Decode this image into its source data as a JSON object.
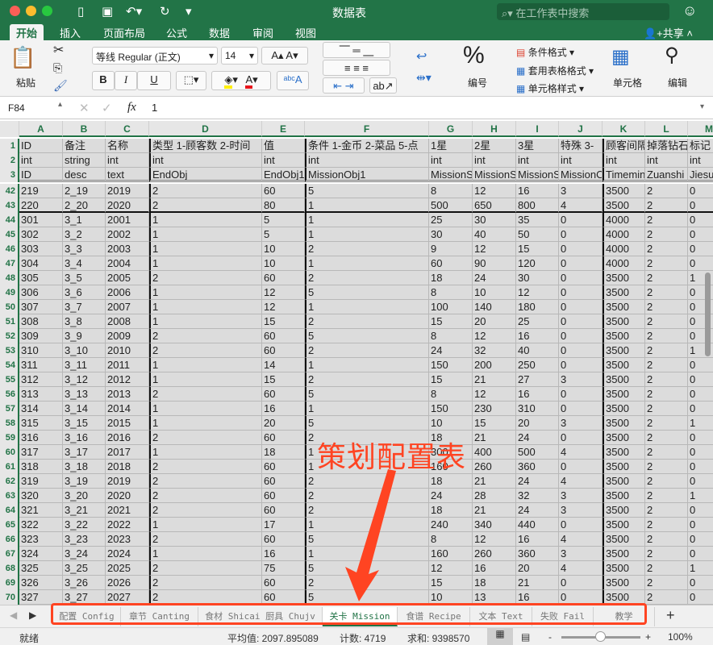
{
  "window": {
    "title": "数据表",
    "search_placeholder": "在工作表中搜索"
  },
  "ribbon_tabs": [
    "开始",
    "插入",
    "页面布局",
    "公式",
    "数据",
    "审阅",
    "视图"
  ],
  "share_label": "共享",
  "ribbon": {
    "paste": "粘贴",
    "font_name": "等线 Regular (正文)",
    "font_size": "14",
    "bold": "B",
    "italic": "I",
    "underline": "U",
    "number": "编号",
    "number_symbol": "%",
    "cond_format": "条件格式",
    "table_format": "套用表格格式",
    "cell_style": "单元格样式",
    "cells": "单元格",
    "edit": "编辑",
    "colors": {
      "highlight": "#ffef00",
      "font_color": "#e8141b"
    }
  },
  "formula_bar": {
    "name_box": "F84",
    "fx": "fx",
    "value": "1"
  },
  "columns": [
    "A",
    "B",
    "C",
    "D",
    "E",
    "F",
    "G",
    "H",
    "I",
    "J",
    "K",
    "L",
    "M"
  ],
  "header_rows": [
    {
      "num": "1",
      "cells": [
        "ID",
        "备注",
        "名称",
        "类型 1-顾客数 2-时间",
        "值",
        "条件 1-金币 2-菜品 5-点",
        "1星",
        "2星",
        "3星",
        "特殊 3-",
        "顾客间隔",
        "掉落钻石",
        "标记"
      ]
    },
    {
      "num": "2",
      "cells": [
        "int",
        "string",
        "int",
        "int",
        "int",
        "int",
        "int",
        "int",
        "int",
        "int",
        "int",
        "int",
        "int"
      ]
    },
    {
      "num": "3",
      "cells": [
        "ID",
        "desc",
        "text",
        "EndObj",
        "EndObj1",
        "MissionObj1",
        "MissionS",
        "MissionS",
        "MissionS",
        "MissionO",
        "Timemin",
        "Zuanshi",
        "Jiesu"
      ]
    }
  ],
  "rows": [
    {
      "num": "42",
      "cells": [
        "219",
        "2_19",
        "2019",
        "2",
        "60",
        "5",
        "8",
        "12",
        "16",
        "3",
        "3500",
        "2",
        "0"
      ]
    },
    {
      "num": "43",
      "cells": [
        "220",
        "2_20",
        "2020",
        "2",
        "80",
        "1",
        "500",
        "650",
        "800",
        "4",
        "3500",
        "2",
        "0"
      ]
    },
    {
      "num": "44",
      "cells": [
        "301",
        "3_1",
        "2001",
        "1",
        "5",
        "1",
        "25",
        "30",
        "35",
        "0",
        "4000",
        "2",
        "0"
      ]
    },
    {
      "num": "45",
      "cells": [
        "302",
        "3_2",
        "2002",
        "1",
        "5",
        "1",
        "30",
        "40",
        "50",
        "0",
        "4000",
        "2",
        "0"
      ]
    },
    {
      "num": "46",
      "cells": [
        "303",
        "3_3",
        "2003",
        "1",
        "10",
        "2",
        "9",
        "12",
        "15",
        "0",
        "4000",
        "2",
        "0"
      ]
    },
    {
      "num": "47",
      "cells": [
        "304",
        "3_4",
        "2004",
        "1",
        "10",
        "1",
        "60",
        "90",
        "120",
        "0",
        "4000",
        "2",
        "0"
      ]
    },
    {
      "num": "48",
      "cells": [
        "305",
        "3_5",
        "2005",
        "2",
        "60",
        "2",
        "18",
        "24",
        "30",
        "0",
        "3500",
        "2",
        "1"
      ]
    },
    {
      "num": "49",
      "cells": [
        "306",
        "3_6",
        "2006",
        "1",
        "12",
        "5",
        "8",
        "10",
        "12",
        "0",
        "3500",
        "2",
        "0"
      ]
    },
    {
      "num": "50",
      "cells": [
        "307",
        "3_7",
        "2007",
        "1",
        "12",
        "1",
        "100",
        "140",
        "180",
        "0",
        "3500",
        "2",
        "0"
      ]
    },
    {
      "num": "51",
      "cells": [
        "308",
        "3_8",
        "2008",
        "1",
        "15",
        "2",
        "15",
        "20",
        "25",
        "0",
        "3500",
        "2",
        "0"
      ]
    },
    {
      "num": "52",
      "cells": [
        "309",
        "3_9",
        "2009",
        "2",
        "60",
        "5",
        "8",
        "12",
        "16",
        "0",
        "3500",
        "2",
        "0"
      ]
    },
    {
      "num": "53",
      "cells": [
        "310",
        "3_10",
        "2010",
        "2",
        "60",
        "2",
        "24",
        "32",
        "40",
        "0",
        "3500",
        "2",
        "1"
      ]
    },
    {
      "num": "54",
      "cells": [
        "311",
        "3_11",
        "2011",
        "1",
        "14",
        "1",
        "150",
        "200",
        "250",
        "0",
        "3500",
        "2",
        "0"
      ]
    },
    {
      "num": "55",
      "cells": [
        "312",
        "3_12",
        "2012",
        "1",
        "15",
        "2",
        "15",
        "21",
        "27",
        "3",
        "3500",
        "2",
        "0"
      ]
    },
    {
      "num": "56",
      "cells": [
        "313",
        "3_13",
        "2013",
        "2",
        "60",
        "5",
        "8",
        "12",
        "16",
        "0",
        "3500",
        "2",
        "0"
      ]
    },
    {
      "num": "57",
      "cells": [
        "314",
        "3_14",
        "2014",
        "1",
        "16",
        "1",
        "150",
        "230",
        "310",
        "0",
        "3500",
        "2",
        "0"
      ]
    },
    {
      "num": "58",
      "cells": [
        "315",
        "3_15",
        "2015",
        "1",
        "20",
        "5",
        "10",
        "15",
        "20",
        "3",
        "3500",
        "2",
        "1"
      ]
    },
    {
      "num": "59",
      "cells": [
        "316",
        "3_16",
        "2016",
        "2",
        "60",
        "2",
        "18",
        "21",
        "24",
        "0",
        "3500",
        "2",
        "0"
      ]
    },
    {
      "num": "60",
      "cells": [
        "317",
        "3_17",
        "2017",
        "1",
        "18",
        "1",
        "300",
        "400",
        "500",
        "4",
        "3500",
        "2",
        "0"
      ]
    },
    {
      "num": "61",
      "cells": [
        "318",
        "3_18",
        "2018",
        "2",
        "60",
        "1",
        "160",
        "260",
        "360",
        "0",
        "3500",
        "2",
        "0"
      ]
    },
    {
      "num": "62",
      "cells": [
        "319",
        "3_19",
        "2019",
        "2",
        "60",
        "2",
        "18",
        "21",
        "24",
        "4",
        "3500",
        "2",
        "0"
      ]
    },
    {
      "num": "63",
      "cells": [
        "320",
        "3_20",
        "2020",
        "2",
        "60",
        "2",
        "24",
        "28",
        "32",
        "3",
        "3500",
        "2",
        "1"
      ]
    },
    {
      "num": "64",
      "cells": [
        "321",
        "3_21",
        "2021",
        "2",
        "60",
        "2",
        "18",
        "21",
        "24",
        "3",
        "3500",
        "2",
        "0"
      ]
    },
    {
      "num": "65",
      "cells": [
        "322",
        "3_22",
        "2022",
        "1",
        "17",
        "1",
        "240",
        "340",
        "440",
        "0",
        "3500",
        "2",
        "0"
      ]
    },
    {
      "num": "66",
      "cells": [
        "323",
        "3_23",
        "2023",
        "2",
        "60",
        "5",
        "8",
        "12",
        "16",
        "4",
        "3500",
        "2",
        "0"
      ]
    },
    {
      "num": "67",
      "cells": [
        "324",
        "3_24",
        "2024",
        "1",
        "16",
        "1",
        "160",
        "260",
        "360",
        "3",
        "3500",
        "2",
        "0"
      ]
    },
    {
      "num": "68",
      "cells": [
        "325",
        "3_25",
        "2025",
        "2",
        "75",
        "5",
        "12",
        "16",
        "20",
        "4",
        "3500",
        "2",
        "1"
      ]
    },
    {
      "num": "69",
      "cells": [
        "326",
        "3_26",
        "2026",
        "2",
        "60",
        "2",
        "15",
        "18",
        "21",
        "0",
        "3500",
        "2",
        "0"
      ]
    },
    {
      "num": "70",
      "cells": [
        "327",
        "3_27",
        "2027",
        "2",
        "60",
        "5",
        "10",
        "13",
        "16",
        "0",
        "3500",
        "2",
        "0"
      ]
    }
  ],
  "sheet_tabs": [
    "配置 Config",
    "章节 Canting",
    "食材 Shicai 厨具 Chujv",
    "关卡 Mission",
    "食谱 Recipe",
    "文本 Text",
    "失败 Fail",
    "教学"
  ],
  "active_sheet": "关卡 Mission",
  "add_sheet": "+",
  "status": {
    "ready": "就绪",
    "average": "平均值: 2097.895089",
    "count": "计数: 4719",
    "sum": "求和: 9398570",
    "zoom": "100%",
    "zoom_minus": "-",
    "zoom_plus": "+",
    "zoom_level": 1.0
  },
  "annotation": {
    "text": "策划配置表",
    "color": "#ff4422"
  }
}
